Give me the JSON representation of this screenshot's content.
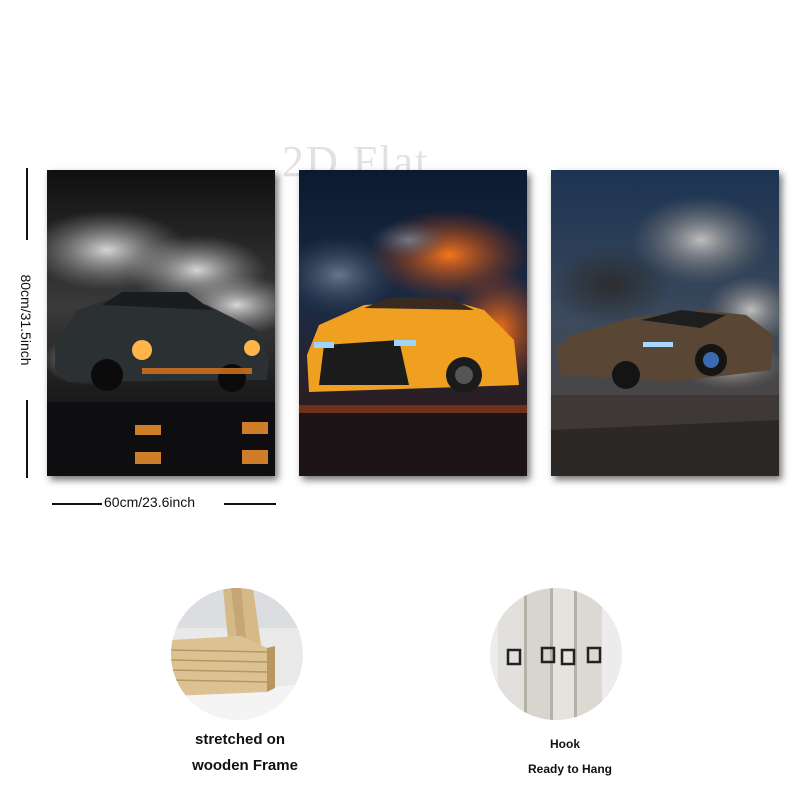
{
  "watermark": "2D Flat",
  "dimensions": {
    "height_label": "80cm/31.5inch",
    "width_label": "60cm/23.6inch"
  },
  "panels": [
    {
      "subject": "black-sports-car-drifting-in-smoke"
    },
    {
      "subject": "orange-sedan-in-fire-smoke"
    },
    {
      "subject": "supercar-drifting-in-smoke"
    }
  ],
  "details": [
    {
      "icon": "wooden-frame-corner-image",
      "caption_line1": "stretched on",
      "caption_line2": "wooden Frame"
    },
    {
      "icon": "hook-image",
      "caption_line1": "Hook",
      "caption_line2": "Ready to Hang"
    }
  ],
  "colors": {
    "background": "#ffffff",
    "text": "#111111",
    "fire_orange": "#e8601c",
    "wood": "#d9bd8f"
  }
}
